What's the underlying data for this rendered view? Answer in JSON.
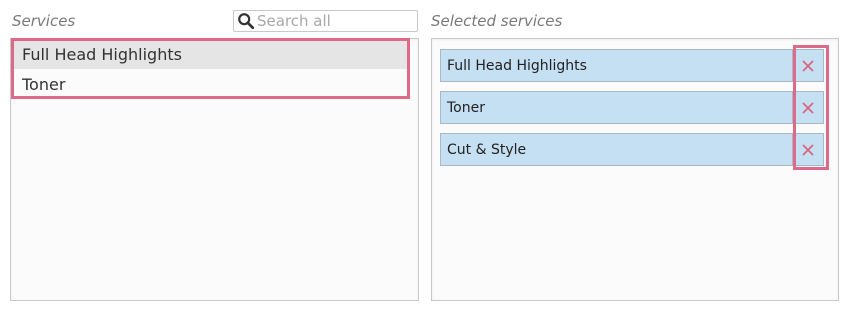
{
  "services": {
    "label": "Services",
    "search_placeholder": "Search all",
    "items": [
      {
        "label": "Full Head Highlights"
      },
      {
        "label": "Toner"
      }
    ]
  },
  "selected": {
    "label": "Selected services",
    "items": [
      {
        "label": "Full Head Highlights"
      },
      {
        "label": "Toner"
      },
      {
        "label": "Cut & Style"
      }
    ]
  },
  "colors": {
    "highlight_border": "#de6a8a",
    "selected_row_bg": "#c5dff3",
    "remove_icon": "#d9667f"
  },
  "icons": {
    "search": "search-icon",
    "remove": "close-icon"
  }
}
